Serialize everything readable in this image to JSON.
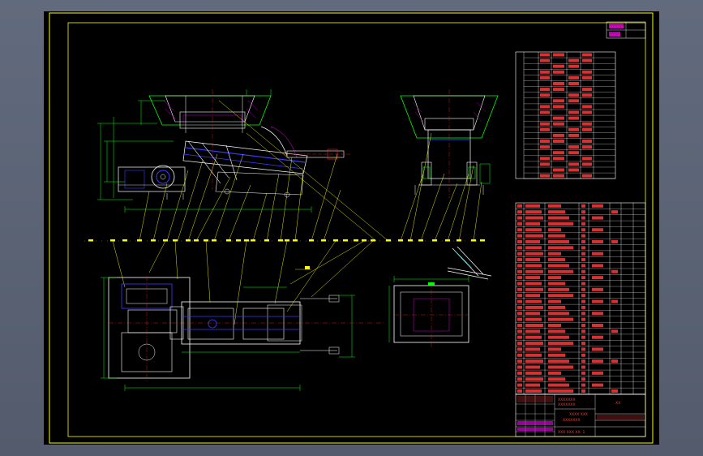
{
  "drawing": {
    "title_block": {
      "label_left": "XXXXXXX",
      "label_right": "XXXXXXX",
      "drawing_name_line1": "XXXX XXX",
      "drawing_name_line2": "XXXXXXX",
      "marks": "XX",
      "footer": "XXX XXX XX: 1"
    },
    "corner_block": [
      "XXXXXX XX",
      "XXXXXX"
    ],
    "colors": {
      "sheet": "#000000",
      "frame": "#ffff00",
      "table_red": "#ff3a3a",
      "table_grid": "#ffffff",
      "leader_yellow": "#ffff00",
      "dim_green": "#00ff00",
      "part_blue": "#3c3cff",
      "part_white": "#ffffff",
      "center_red": "#ff2020",
      "accent_magenta": "#ff00ff",
      "accent_cyan": "#00ffff"
    }
  }
}
